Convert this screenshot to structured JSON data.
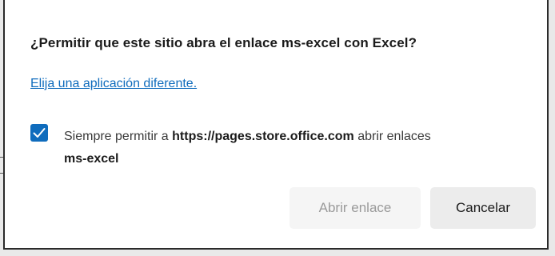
{
  "dialog": {
    "title": "¿Permitir que este sitio abra el enlace ms-excel con Excel?",
    "choose_app_link": "Elija una aplicación diferente.",
    "always_allow": {
      "checked": true,
      "prefix": "Siempre permitir a ",
      "site": "https://pages.store.office.com",
      "middle": " abrir enlaces ",
      "protocol": "ms-excel"
    },
    "buttons": {
      "open_label": "Abrir enlace",
      "cancel_label": "Cancelar"
    }
  },
  "colors": {
    "accent": "#0f6cbd",
    "disabled_text": "#9a9a9a"
  },
  "icons": {
    "checkbox": "checkmark-icon"
  }
}
